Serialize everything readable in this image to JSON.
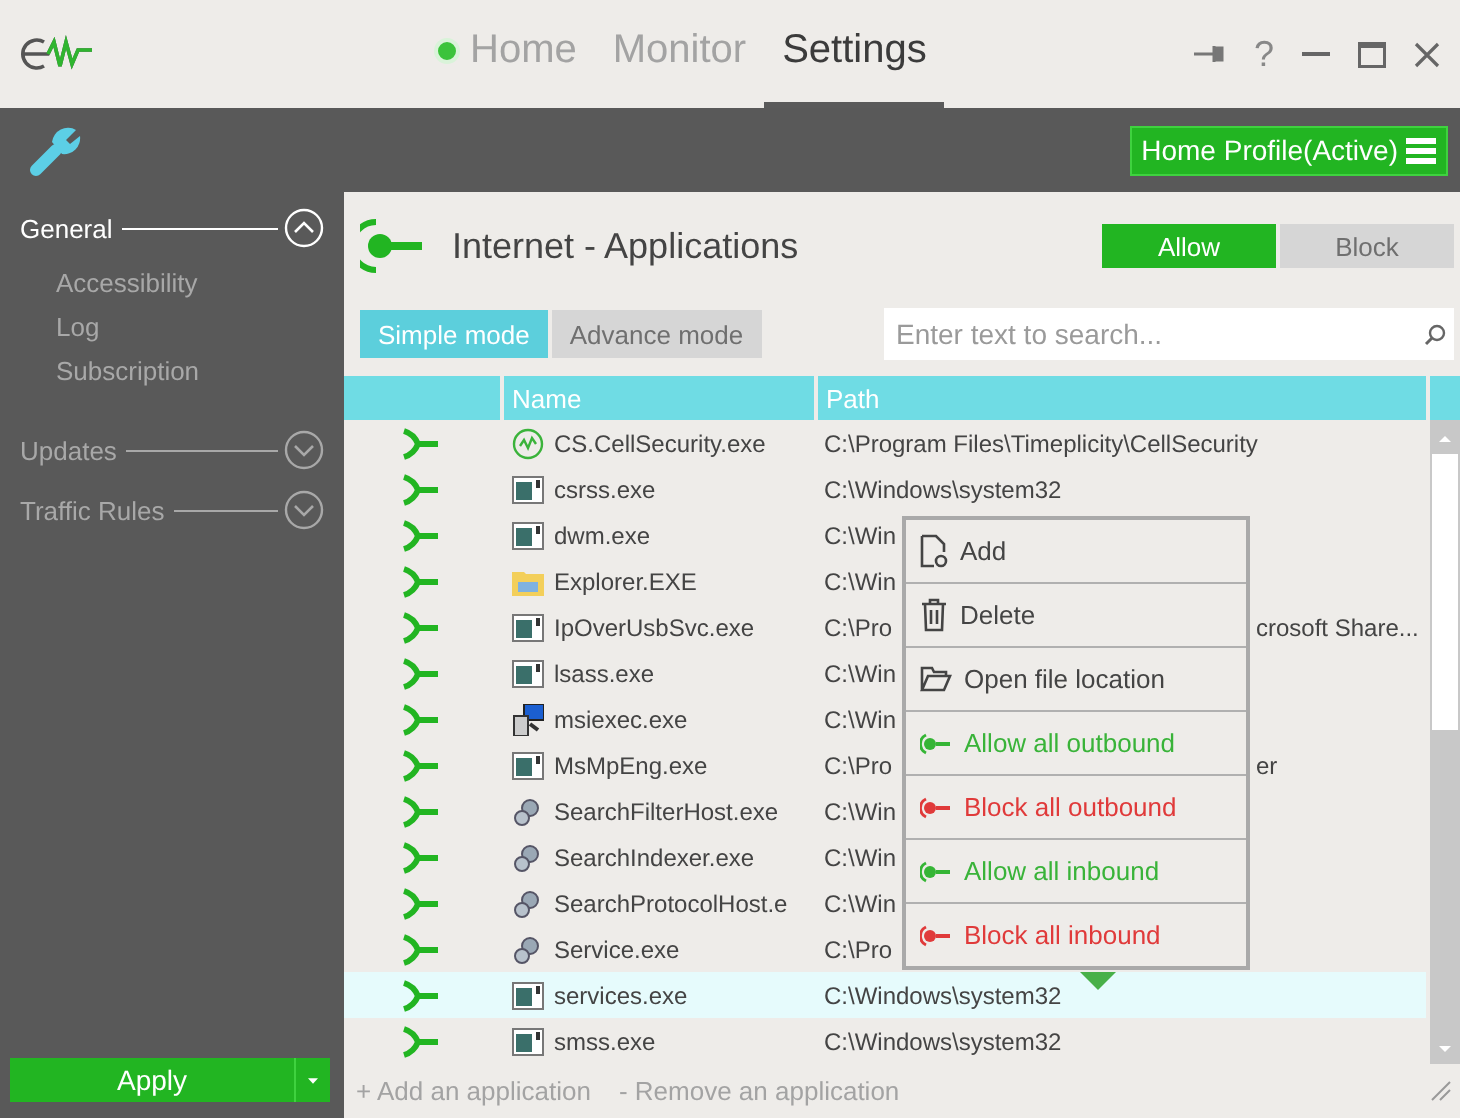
{
  "tabs": [
    {
      "label": "Home",
      "selected": false,
      "indicator": true
    },
    {
      "label": "Monitor",
      "selected": false,
      "indicator": false
    },
    {
      "label": "Settings",
      "selected": true,
      "indicator": false
    }
  ],
  "help_label": "?",
  "profile": {
    "label": "Home Profile(Active)"
  },
  "sidebar": {
    "sections": [
      {
        "label": "General",
        "expanded": true,
        "children": [
          {
            "label": "Accessibility"
          },
          {
            "label": "Log"
          },
          {
            "label": "Subscription"
          }
        ]
      },
      {
        "label": "Updates",
        "expanded": false
      },
      {
        "label": "Traffic Rules",
        "expanded": false
      }
    ],
    "apply": "Apply"
  },
  "header": {
    "title": "Internet - Applications",
    "actions": [
      {
        "label": "Allow",
        "selected": true
      },
      {
        "label": "Block",
        "selected": false
      }
    ]
  },
  "modes": [
    {
      "label": "Simple mode",
      "selected": true
    },
    {
      "label": "Advance mode",
      "selected": false
    }
  ],
  "search": {
    "placeholder": "Enter text to search..."
  },
  "table": {
    "columns": [
      "Name",
      "Path"
    ],
    "rows": [
      {
        "name": "CS.CellSecurity.exe",
        "kind": "logo",
        "path": "C:\\Program Files\\Timeplicity\\CellSecurity",
        "selected": false
      },
      {
        "name": "csrss.exe",
        "kind": "window",
        "path": "C:\\Windows\\system32",
        "selected": false
      },
      {
        "name": "dwm.exe",
        "kind": "window",
        "path": "C:\\Win",
        "selected": false
      },
      {
        "name": "Explorer.EXE",
        "kind": "folder",
        "path": "C:\\Win",
        "selected": false
      },
      {
        "name": "IpOverUsbSvc.exe",
        "kind": "window",
        "path": "C:\\Pro",
        "path_tail": "crosoft Share...",
        "selected": false
      },
      {
        "name": "lsass.exe",
        "kind": "window",
        "path": "C:\\Win",
        "selected": false
      },
      {
        "name": "msiexec.exe",
        "kind": "installer",
        "path": "C:\\Win",
        "selected": false
      },
      {
        "name": "MsMpEng.exe",
        "kind": "window",
        "path": "C:\\Pro",
        "path_tail": "er",
        "selected": false
      },
      {
        "name": "SearchFilterHost.exe",
        "kind": "service",
        "path": "C:\\Win",
        "selected": false
      },
      {
        "name": "SearchIndexer.exe",
        "kind": "service",
        "path": "C:\\Win",
        "selected": false
      },
      {
        "name": "SearchProtocolHost.e",
        "kind": "service",
        "path": "C:\\Win",
        "selected": false
      },
      {
        "name": "Service.exe",
        "kind": "service",
        "path": "C:\\Pro",
        "selected": false
      },
      {
        "name": "services.exe",
        "kind": "window",
        "path": "C:\\Windows\\system32",
        "selected": true
      },
      {
        "name": "smss.exe",
        "kind": "window",
        "path": "C:\\Windows\\system32",
        "selected": false
      }
    ]
  },
  "context_menu": {
    "items": [
      {
        "label": "Add",
        "kind": "add"
      },
      {
        "label": "Delete",
        "kind": "delete"
      },
      {
        "label": "Open file location",
        "kind": "open"
      },
      {
        "label": "Allow all outbound",
        "kind": "allow"
      },
      {
        "label": "Block all outbound",
        "kind": "block"
      },
      {
        "label": "Allow all inbound",
        "kind": "allow"
      },
      {
        "label": "Block all inbound",
        "kind": "block"
      }
    ]
  },
  "footer": {
    "actions": [
      "+ Add an application",
      "- Remove an application"
    ]
  }
}
